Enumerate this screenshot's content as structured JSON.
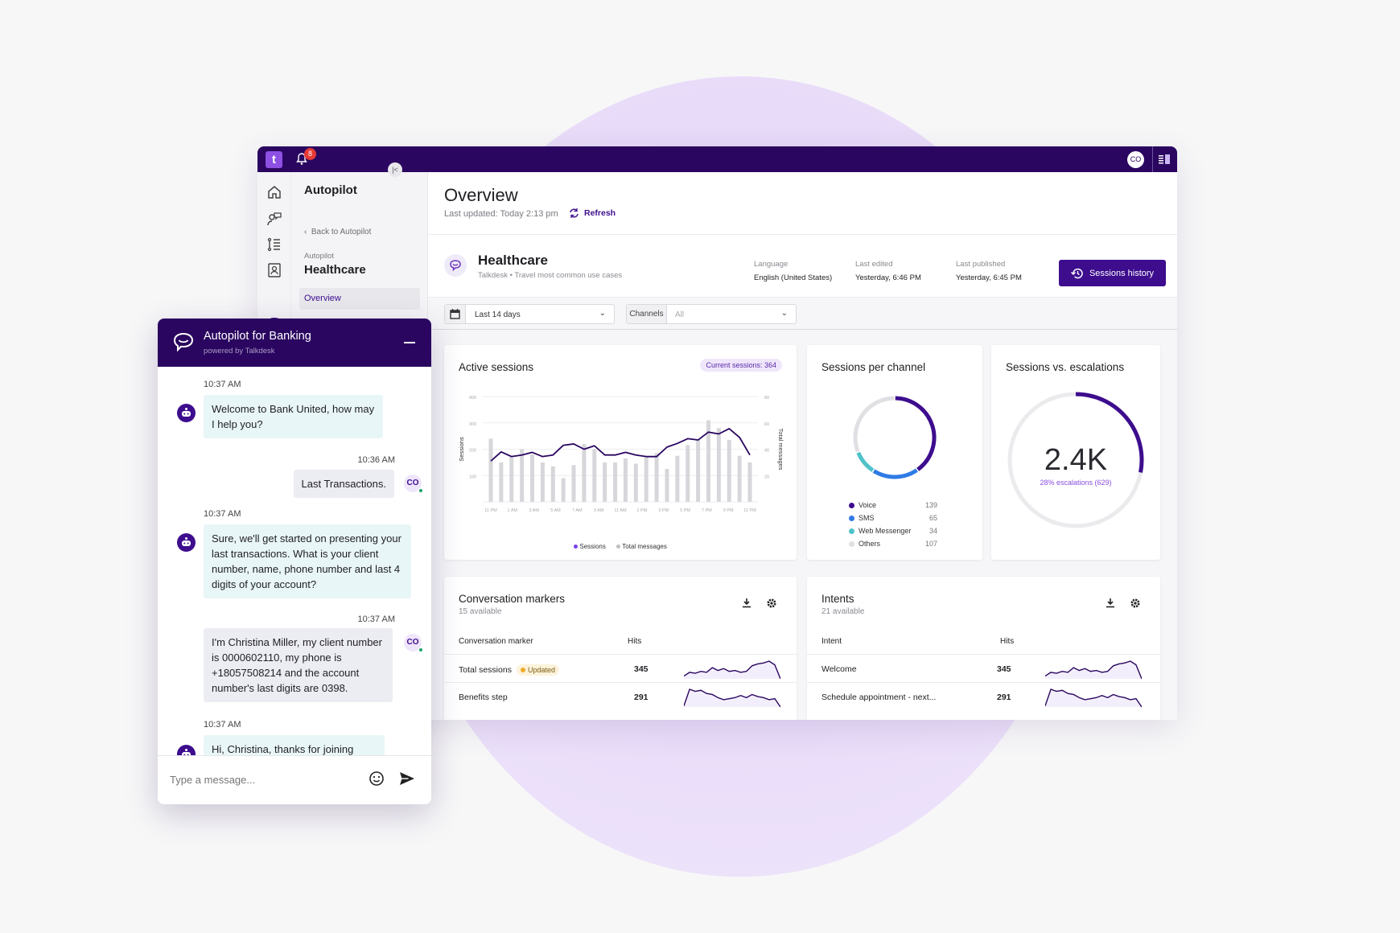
{
  "topbar": {
    "notification_count": "8",
    "user_initials": "CO",
    "logo_glyph": "t"
  },
  "rail": {
    "icons": [
      "home-icon",
      "conversation-icon",
      "list-icon",
      "contacts-icon",
      "autopilot-icon"
    ]
  },
  "subnav": {
    "title": "Autopilot",
    "back_link": "Back to Autopilot",
    "crumb": "Autopilot",
    "heading": "Healthcare",
    "active_item": "Overview"
  },
  "page": {
    "title": "Overview",
    "last_updated": "Last updated: Today 2:13 pm",
    "refresh_label": "Refresh"
  },
  "bot": {
    "name": "Healthcare",
    "subtitle": "Talkdesk  •  Travel most common use cases",
    "meta": [
      {
        "key": "Language",
        "value": "English (United States)"
      },
      {
        "key": "Last edited",
        "value": "Yesterday, 6:46 PM"
      },
      {
        "key": "Last published",
        "value": "Yesterday, 6:45 PM"
      }
    ],
    "sessions_history_label": "Sessions history"
  },
  "filters": {
    "date_range": "Last 14 days",
    "channels_label": "Channels",
    "channels_value": "All"
  },
  "colors": {
    "brand": "#2a0660",
    "accent": "#3d0d8e",
    "voice": "#3d0d8e",
    "sms": "#2f7be6",
    "web": "#4fc3c9",
    "others": "#e0e0e4"
  },
  "active_sessions": {
    "title": "Active sessions",
    "current_pill": "Current sessions: 364"
  },
  "sessions_per_channel": {
    "title": "Sessions per channel"
  },
  "sessions_vs_escalations": {
    "title": "Sessions vs. escalations",
    "total": "2.4K",
    "caption": "28% escalations (629)",
    "escalation_fraction": 0.28
  },
  "chart_data": [
    {
      "type": "bar",
      "title": "Active sessions",
      "ylabel": "Sessions",
      "y2label": "Total messages",
      "ylim": [
        0,
        400
      ],
      "y2lim": [
        0,
        80
      ],
      "yticks": [
        100,
        200,
        300,
        400
      ],
      "y2ticks": [
        20,
        40,
        60,
        80
      ],
      "xtick_labels": [
        "11 PM",
        "1 AM",
        "3 AM",
        "5 AM",
        "7 AM",
        "9 AM",
        "11 AM",
        "1 PM",
        "3 PM",
        "5 PM",
        "7 PM",
        "9 PM",
        "11 PM"
      ],
      "grid": true,
      "legend": "bottom",
      "series": [
        {
          "name": "Sessions",
          "kind": "line",
          "values": [
            155,
            190,
            172,
            178,
            188,
            172,
            178,
            215,
            220,
            200,
            213,
            178,
            178,
            188,
            178,
            172,
            172,
            208,
            222,
            240,
            235,
            265,
            258,
            278,
            245,
            178
          ]
        },
        {
          "name": "Total messages",
          "kind": "bar",
          "values": [
            48,
            30,
            34,
            40,
            36,
            30,
            27,
            18,
            28,
            44,
            40,
            30,
            30,
            33,
            29,
            34,
            37,
            25,
            35,
            43,
            47,
            62,
            56,
            47,
            35,
            30
          ]
        }
      ]
    },
    {
      "type": "pie",
      "title": "Sessions per channel",
      "categories": [
        "Voice",
        "SMS",
        "Web Messenger",
        "Others"
      ],
      "values": [
        139,
        65,
        34,
        107
      ],
      "legend": "bottom"
    },
    {
      "type": "pie",
      "title": "Sessions vs. escalations",
      "categories": [
        "Escalations",
        "Non-escalated"
      ],
      "values": [
        629,
        1771
      ]
    }
  ],
  "conversation_markers": {
    "title": "Conversation markers",
    "subtitle": "15 available",
    "col_name": "Conversation marker",
    "col_hits": "Hits",
    "rows": [
      {
        "name": "Total sessions",
        "badge": "Updated",
        "hits": "345",
        "trend": [
          4,
          8,
          7,
          9,
          8,
          13,
          10,
          12,
          9,
          10,
          8,
          9,
          15,
          17,
          18,
          20,
          16,
          1
        ]
      },
      {
        "name": "Benefits step",
        "badge": "",
        "hits": "291",
        "trend": [
          2,
          18,
          16,
          17,
          14,
          13,
          10,
          8,
          9,
          10,
          12,
          10,
          13,
          11,
          10,
          8,
          9,
          1
        ]
      }
    ]
  },
  "intents": {
    "title": "Intents",
    "subtitle": "21 available",
    "col_name": "Intent",
    "col_hits": "Hits",
    "rows": [
      {
        "name": "Welcome",
        "hits": "345",
        "trend": [
          4,
          8,
          7,
          9,
          8,
          13,
          10,
          12,
          9,
          10,
          8,
          9,
          15,
          17,
          18,
          20,
          16,
          1
        ]
      },
      {
        "name": "Schedule appointment - next...",
        "hits": "291",
        "trend": [
          2,
          18,
          16,
          17,
          14,
          13,
          10,
          8,
          9,
          10,
          12,
          10,
          13,
          11,
          10,
          8,
          9,
          1
        ]
      }
    ]
  },
  "chat": {
    "title": "Autopilot for Banking",
    "subtitle": "powered by Talkdesk",
    "user_initials": "CO",
    "messages": [
      {
        "from": "bot",
        "time": "10:37 AM",
        "text": "Welcome to Bank United, how may I help you?"
      },
      {
        "from": "user",
        "time": "10:36 AM",
        "text": "Last Transactions."
      },
      {
        "from": "bot",
        "time": "10:37 AM",
        "text": "Sure, we'll get started on presenting your last transactions. What is your client number, name, phone number and last 4 digits of your account?"
      },
      {
        "from": "user",
        "time": "10:37 AM",
        "text": "I'm Christina Miller, my client number is 0000602110, my phone is +18057508214 and the account number's last digits are 0398."
      },
      {
        "from": "bot",
        "time": "10:37 AM",
        "text": "Hi, Christina, thanks for joining here"
      }
    ],
    "input_placeholder": "Type a message..."
  }
}
